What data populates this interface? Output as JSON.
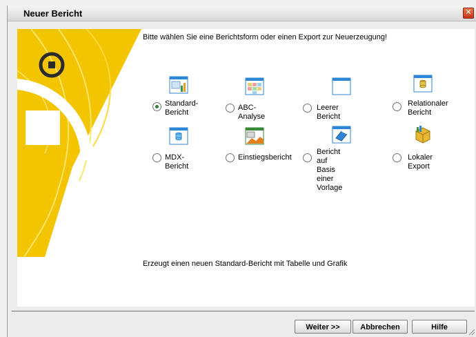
{
  "window": {
    "title": "Neuer Bericht",
    "close_label": "✕"
  },
  "intro_text": "Bitte wählen Sie eine Berichtsform oder einen Export zur Neuerzeugung!",
  "description_text": "Erzeugt einen neuen Standard-Bericht mit Tabelle und Grafik",
  "options": [
    {
      "line1": "Standard-",
      "line2": "Bericht",
      "icon": "table-chart-icon",
      "checked": true
    },
    {
      "line1": "ABC-Analyse",
      "line2": "",
      "icon": "abc-grid-icon",
      "checked": false
    },
    {
      "line1": "Leerer Bericht",
      "line2": "",
      "icon": "blank-window-icon",
      "checked": false
    },
    {
      "line1": "Relationaler",
      "line2": "Bericht",
      "icon": "database-window-icon",
      "checked": false
    },
    {
      "line1": "MDX-Bericht",
      "line2": "",
      "icon": "database-window-icon",
      "checked": false
    },
    {
      "line1": "Einstiegsbericht",
      "line2": "",
      "icon": "landscape-window-icon",
      "checked": false
    },
    {
      "line1": "Bericht auf Basis",
      "line2": "einer Vorlage",
      "icon": "template-book-icon",
      "checked": false
    },
    {
      "line1": "Lokaler Export",
      "line2": "",
      "icon": "cube-export-icon",
      "checked": false
    }
  ],
  "buttons": {
    "next": "Weiter >>",
    "cancel": "Abbrechen",
    "help": "Hilfe"
  },
  "colors": {
    "banner_yellow": "#f2c500",
    "window_icon_blue": "#2e86d6"
  }
}
